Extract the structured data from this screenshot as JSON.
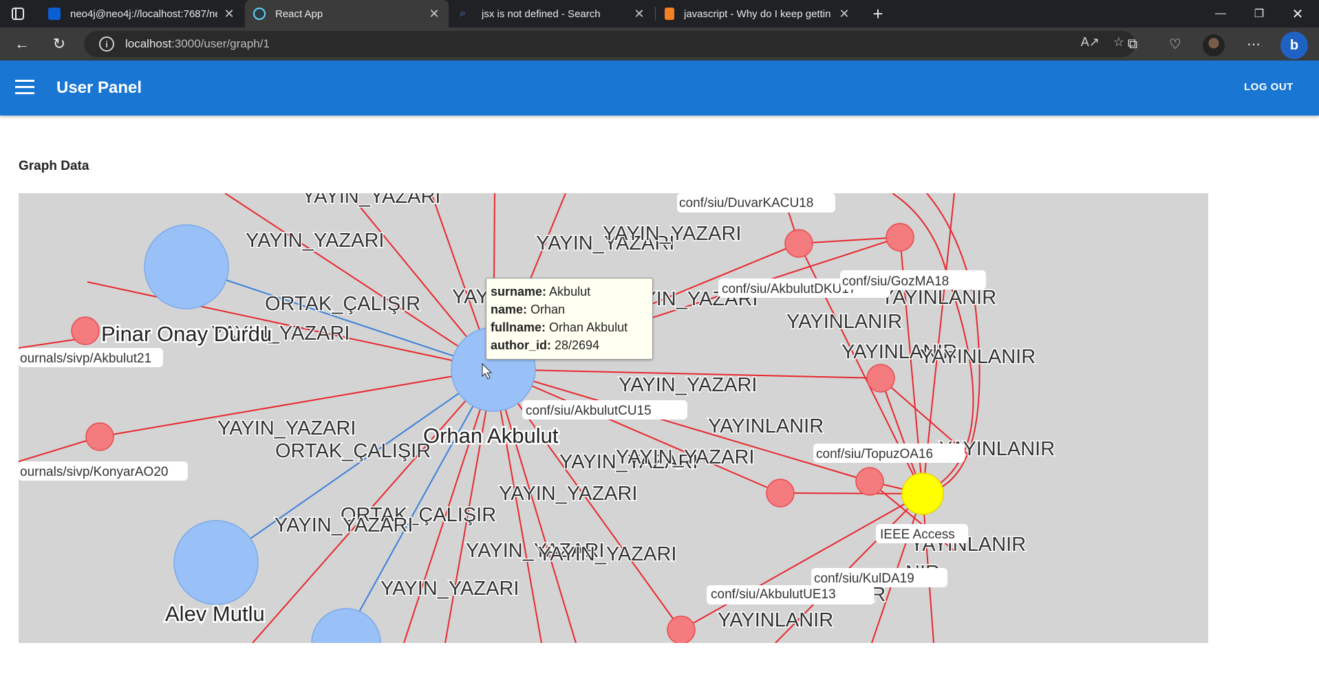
{
  "browser": {
    "tabs": [
      {
        "title": "neo4j@neo4j://localhost:7687/ne",
        "active": false,
        "favicon_color": "#0b5fd3"
      },
      {
        "title": "React App",
        "active": true,
        "favicon_color": "#61dafb"
      },
      {
        "title": "jsx is not defined - Search",
        "active": false,
        "favicon_color": "#3b82f6"
      },
      {
        "title": "javascript - Why do I keep gettin",
        "active": false,
        "favicon_color": "#f48024"
      }
    ],
    "url_host": "localhost",
    "url_path": ":3000/user/graph/1"
  },
  "appbar": {
    "title": "User Panel",
    "logout_label": "LOG OUT",
    "color": "#1976d2"
  },
  "page": {
    "section_title": "Graph Data"
  },
  "graph": {
    "colors": {
      "author_node": "#99c1f8",
      "publication_node": "#f47b7e",
      "venue_node": "#ffff00",
      "yazari_edge": "#e8262c",
      "calisir_edge": "#3a7fdb",
      "background": "#d4d4d4"
    },
    "author_nodes": [
      "Orhan Akbulut",
      "Pinar Onay Durdu",
      "Alev Mutlu"
    ],
    "publication_nodes": [
      "ournals/sivp/Akbulut21",
      "ournals/sivp/KonyarAO20",
      "conf/siu/AkbulutCU15",
      "conf/siu/DuvarKACU18",
      "conf/siu/AkbulutDKU17",
      "conf/siu/GozMA18",
      "conf/siu/TopuzOA16",
      "conf/siu/KulDA19",
      "conf/siu/AkbulutUE13"
    ],
    "venue_nodes": [
      "IEEE Access"
    ],
    "edge_types": {
      "authored": "YAYIN_YAZARI",
      "coworker": "ORTAK_ÇALIŞIR",
      "published_in": "YAYINLANIR"
    },
    "edge_label_fragments": {
      "overlap_yayin": "YAYI",
      "overlap_nir": "NIR"
    },
    "tooltip": {
      "rows": [
        {
          "key": "surname:",
          "value": "Akbulut"
        },
        {
          "key": "name:",
          "value": "Orhan"
        },
        {
          "key": "fullname:",
          "value": "Orhan Akbulut"
        },
        {
          "key": "author_id:",
          "value": "28/2694"
        }
      ]
    }
  }
}
